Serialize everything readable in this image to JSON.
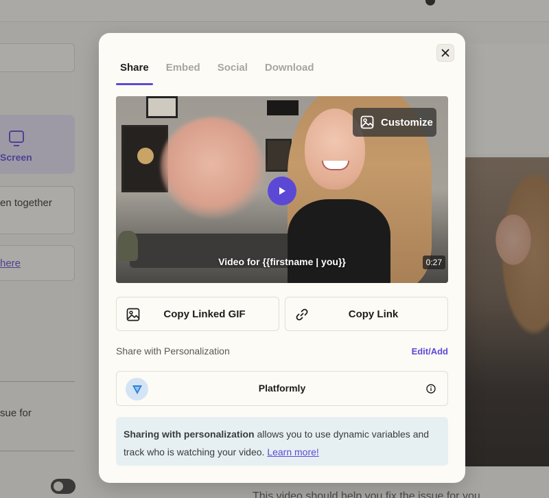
{
  "background": {
    "screen_label": "Screen",
    "snippet_1": "en together",
    "snippet_link": "here",
    "snippet_2": "sue for",
    "bottom_text": "This video should help you fix the issue for you"
  },
  "modal": {
    "tabs": [
      {
        "label": "Share",
        "active": true
      },
      {
        "label": "Embed",
        "active": false
      },
      {
        "label": "Social",
        "active": false
      },
      {
        "label": "Download",
        "active": false
      }
    ],
    "close_icon": "close-icon",
    "video": {
      "customize_label": "Customize",
      "customize_icon": "image-icon",
      "caption": "Video for {{firstname | you}}",
      "duration": "0:27"
    },
    "actions": {
      "copy_gif_label": "Copy Linked GIF",
      "copy_gif_icon": "image-icon",
      "copy_link_label": "Copy Link",
      "copy_link_icon": "link-icon"
    },
    "personalization": {
      "title": "Share with Personalization",
      "edit_label": "Edit/Add",
      "integration_name": "Platformly",
      "integration_icon": "platformly-logo",
      "info_icon": "info-icon"
    },
    "notice": {
      "bold": "Sharing with personalization",
      "text": " allows you to use dynamic variables and track who is watching your video. ",
      "link": "Learn more!"
    }
  },
  "colors": {
    "accent": "#5b49d6",
    "modal_bg": "#fdfbf6",
    "notice_bg": "#e6f0f2"
  }
}
